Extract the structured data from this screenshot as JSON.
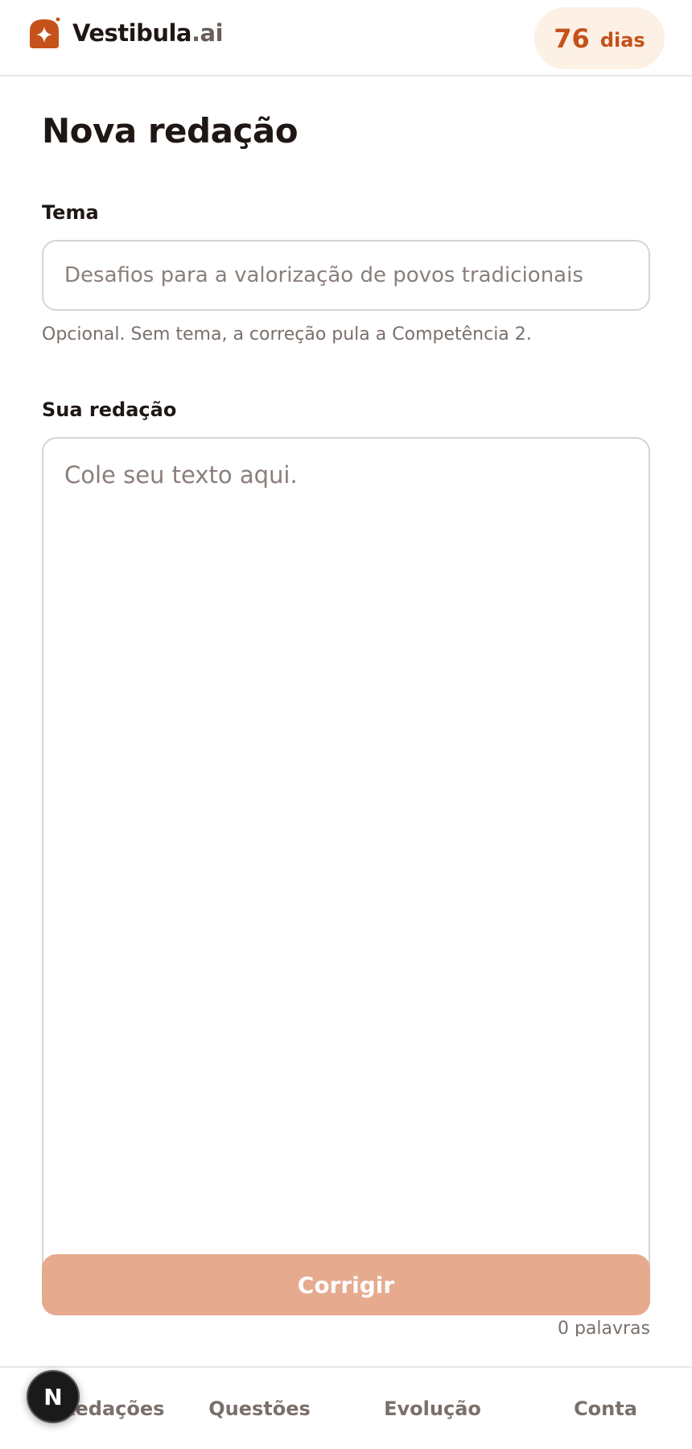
{
  "header": {
    "brand_name": "Vestibula",
    "brand_tld": ".ai",
    "days_count": "76",
    "days_unit": "dias"
  },
  "main": {
    "title": "Nova redação",
    "tema": {
      "label": "Tema",
      "placeholder": "Desafios para a valorização de povos tradicionais",
      "value": "",
      "hint": "Opcional. Sem tema, a correção pula a Competência 2."
    },
    "redacao": {
      "label": "Sua redação",
      "placeholder": "Cole seu texto aqui.",
      "value": "",
      "word_count": "0 palavras"
    },
    "submit_label": "Corrigir"
  },
  "nav": {
    "items": [
      {
        "label": "Redações"
      },
      {
        "label": "Questões"
      },
      {
        "label": "Evolução"
      },
      {
        "label": "Conta"
      }
    ]
  },
  "dev_badge": {
    "letter": "N"
  },
  "colors": {
    "accent": "#c4521a",
    "accent_soft": "#fdf0e4",
    "button_disabled": "#e6aa8f"
  }
}
